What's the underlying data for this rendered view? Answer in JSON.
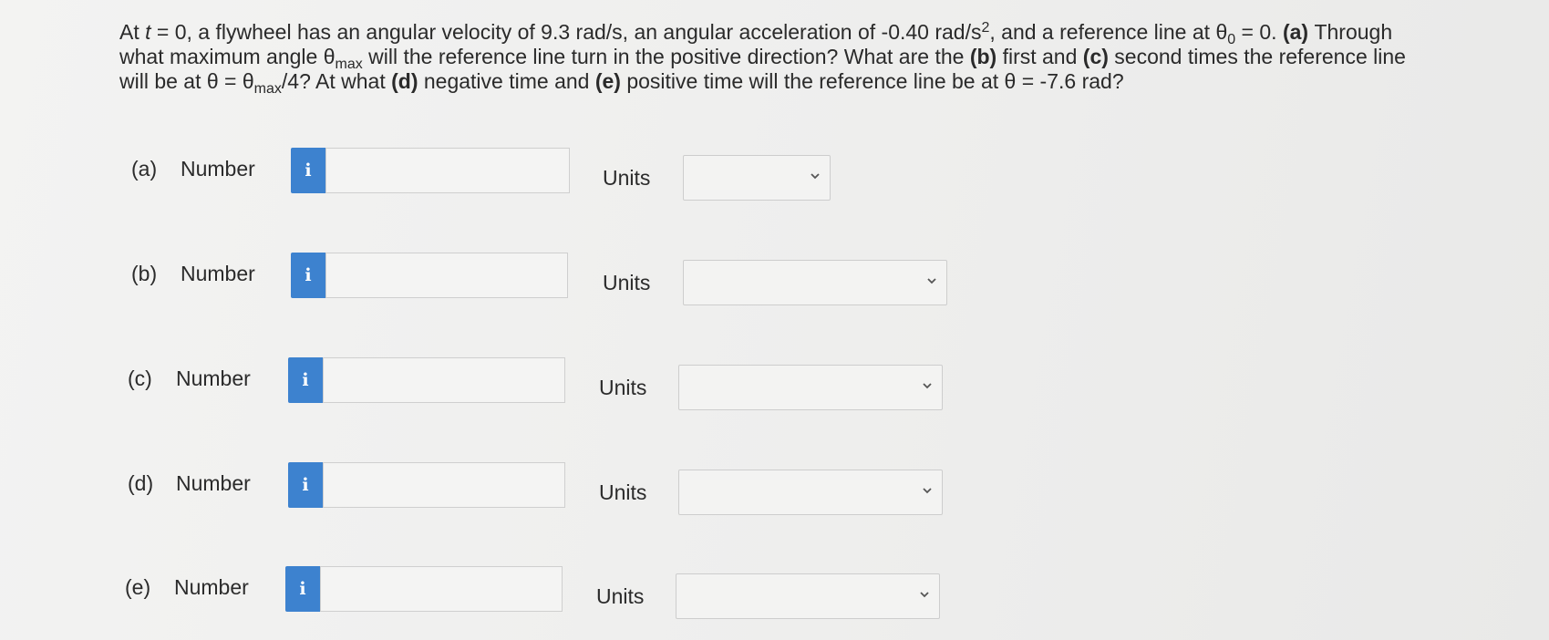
{
  "question": {
    "intro": "At ",
    "t_var": "t",
    "p1": " = 0, a flywheel has an angular velocity of 9.3 rad/s, an angular acceleration of -0.40 rad/s",
    "sup2": "2",
    "p2": ", and a reference line at θ",
    "sub0": "0",
    "p3": " = 0. ",
    "a_tag": "(a)",
    "p4": " Through what maximum angle θ",
    "sub_max1": "max",
    "p5": " will the reference line turn in the positive direction? What are the ",
    "b_tag": "(b)",
    "p6": " first and ",
    "c_tag": "(c)",
    "p7": " second times the reference line will be at θ = θ",
    "sub_max2": "max",
    "p8": "/4? At what ",
    "d_tag": "(d)",
    "p9": " negative time and ",
    "e_tag": "(e)",
    "p10": " positive time will the reference line be at θ = -7.6 rad?"
  },
  "rows": [
    {
      "part": "(a)",
      "number_label": "Number",
      "info": "i",
      "value": "",
      "units_label": "Units",
      "units_value": ""
    },
    {
      "part": "(b)",
      "number_label": "Number",
      "info": "i",
      "value": "",
      "units_label": "Units",
      "units_value": ""
    },
    {
      "part": "(c)",
      "number_label": "Number",
      "info": "i",
      "value": "",
      "units_label": "Units",
      "units_value": ""
    },
    {
      "part": "(d)",
      "number_label": "Number",
      "info": "i",
      "value": "",
      "units_label": "Units",
      "units_value": ""
    },
    {
      "part": "(e)",
      "number_label": "Number",
      "info": "i",
      "value": "",
      "units_label": "Units",
      "units_value": ""
    }
  ],
  "colors": {
    "info_button": "#3d82cf",
    "background": "#f1f1f0",
    "text": "#2b2b2b"
  },
  "icons": {
    "info": "info-icon",
    "dropdown": "chevron-down-icon"
  }
}
